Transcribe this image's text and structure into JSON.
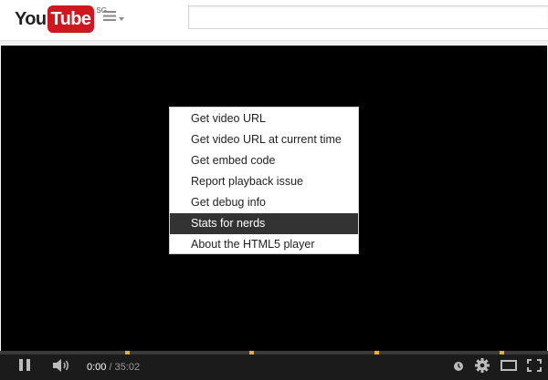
{
  "header": {
    "logo_you": "You",
    "logo_tube": "Tube",
    "logo_region": "SG",
    "guide_icon": "hamburger-menu-icon",
    "search_placeholder": ""
  },
  "context_menu": {
    "items": [
      {
        "label": "Get video URL",
        "active": false
      },
      {
        "label": "Get video URL at current time",
        "active": false
      },
      {
        "label": "Get embed code",
        "active": false
      },
      {
        "label": "Report playback issue",
        "active": false
      },
      {
        "label": "Get debug info",
        "active": false
      },
      {
        "label": "Stats for nerds",
        "active": true
      },
      {
        "label": "About the HTML5 player",
        "active": false
      }
    ]
  },
  "controls": {
    "current_time": "0:00",
    "separator": " / ",
    "duration": "35:02",
    "icons": [
      "pause-icon",
      "volume-icon",
      "watch-later-icon",
      "settings-gear-icon",
      "theater-mode-icon",
      "fullscreen-icon"
    ],
    "progress": 0
  },
  "colors": {
    "brand_red": "#cc181e",
    "ad_marker": "#e7b417",
    "menu_highlight": "#333333"
  }
}
